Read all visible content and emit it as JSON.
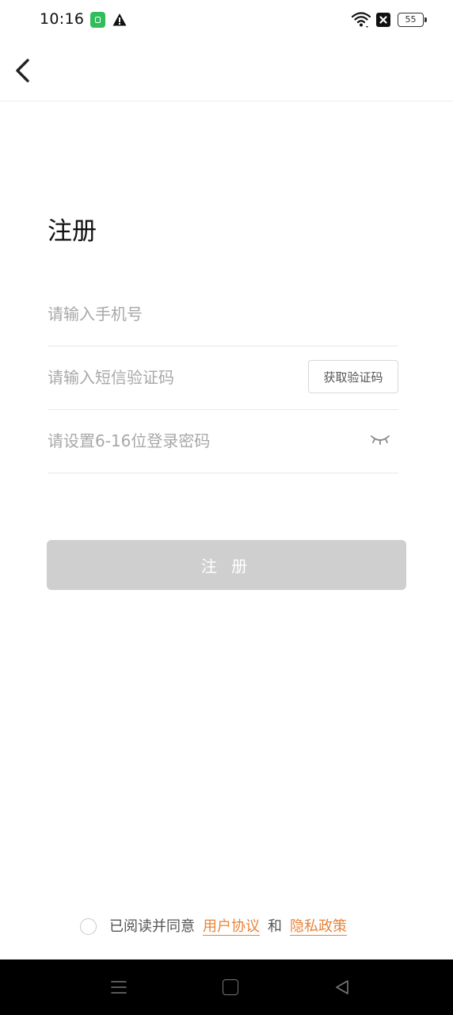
{
  "status_bar": {
    "time": "10:16",
    "battery_level": "55"
  },
  "page": {
    "title": "注册"
  },
  "form": {
    "phone_placeholder": "请输入手机号",
    "code_placeholder": "请输入短信验证码",
    "get_code_label": "获取验证码",
    "password_placeholder": "请设置6-16位登录密码",
    "submit_label": "注 册"
  },
  "agreement": {
    "prefix": "已阅读并同意",
    "user_agreement": "用户协议",
    "and_text": "和",
    "privacy_policy": "隐私政策"
  },
  "colors": {
    "accent": "#e8833a",
    "disabled_button": "#cfcfcf",
    "placeholder": "#a8a8a8"
  },
  "icons": {
    "back": "chevron-left-icon",
    "password_toggle": "eye-closed-icon",
    "checkbox": "circle-checkbox-icon"
  }
}
